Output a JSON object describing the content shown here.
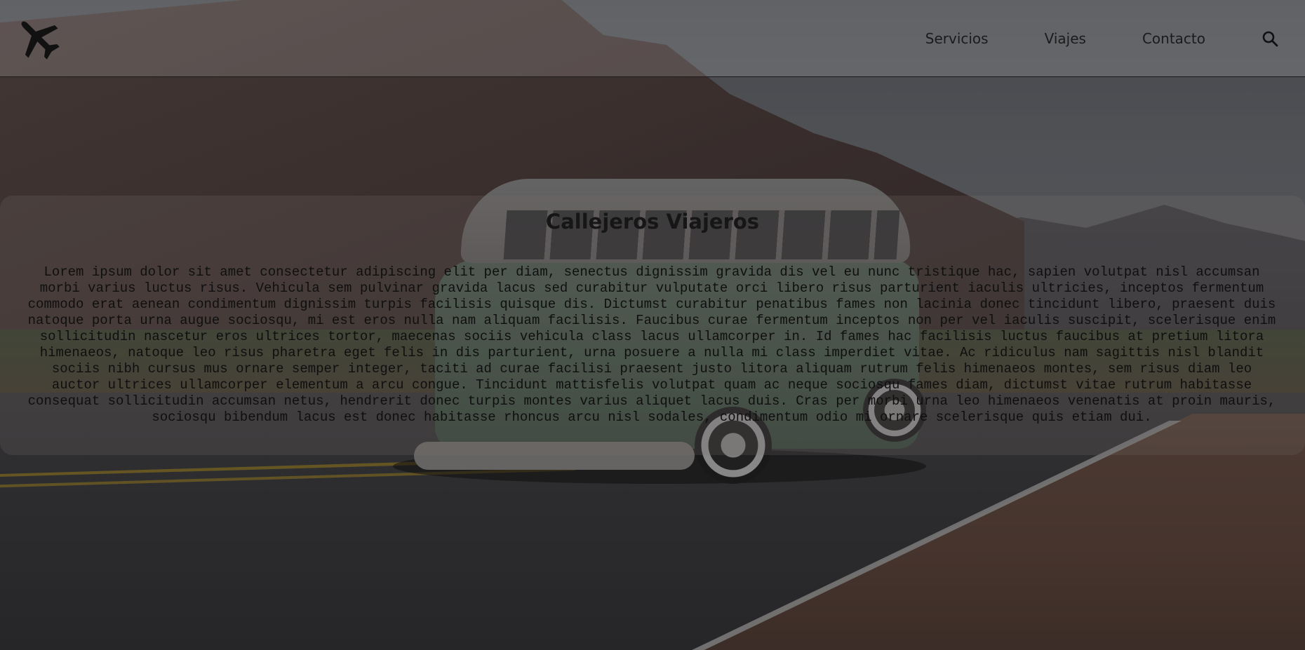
{
  "header": {
    "logo_icon": "airplane-icon",
    "nav": [
      {
        "label": "Servicios"
      },
      {
        "label": "Viajes"
      },
      {
        "label": "Contacto"
      }
    ],
    "search_icon": "search-icon"
  },
  "hero": {
    "background": "vw-bus-on-mountain-road",
    "title": "Callejeros Viajeros",
    "body": "Lorem ipsum dolor sit amet consectetur adipiscing elit per diam, senectus dignissim gravida dis vel eu nunc tristique hac, sapien volutpat nisl accumsan morbi varius luctus risus. Vehicula sem pulvinar gravida lacus sed curabitur vulputate orci libero risus parturient iaculis ultricies, inceptos fermentum commodo erat aenean condimentum dignissim turpis facilisis quisque dis. Dictumst curabitur penatibus fames non lacinia donec tincidunt libero, praesent duis natoque porta urna augue sociosqu, mi est eros nulla nam aliquam facilisis. Faucibus curae fermentum inceptos non per vel iaculis suscipit, scelerisque enim sollicitudin nascetur eros ultrices tortor, maecenas sociis vehicula class lacus ullamcorper in. Id fames hac facilisis luctus faucibus at pretium litora himenaeos, natoque leo risus pharetra eget felis in dis parturient, urna posuere a nulla mi class imperdiet vitae. Ac ridiculus nam sagittis nisl blandit sociis nibh cursus mus ornare semper integer, taciti ad curae facilisi praesent justo litora aliquam rutrum felis himenaeos montes, sem risus diam leo auctor ultrices ullamcorper elementum a arcu congue. Tincidunt mattisfelis volutpat quam ac neque sociosqu fames diam, dictumst vitae rutrum habitasse consequat sollicitudin accumsan netus, hendrerit donec turpis montes varius aliquet lacus duis. Cras per morbi urna leo himenaeos venenatis at proin mauris, sociosqu bibendum lacus est donec habitasse rhoncus arcu nisl sodales, condimentum odio mi ornare scelerisque quis etiam dui."
  },
  "colors": {
    "text": "#161616",
    "nav_text": "#1b1b1b"
  }
}
